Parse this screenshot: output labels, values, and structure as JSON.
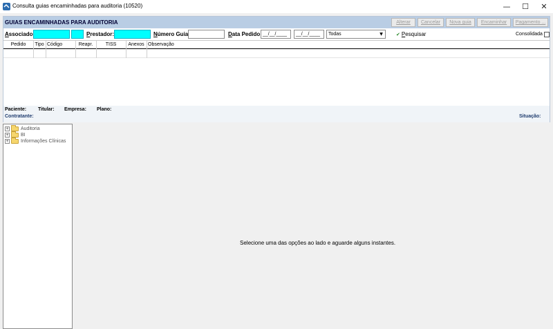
{
  "window": {
    "title": "Consulta guias encaminhadas para auditoria (10520)",
    "controls": {
      "minimize": "—",
      "maximize": "☐",
      "close": "✕"
    }
  },
  "header": {
    "title": "GUIAS ENCAMINHADAS PARA AUDITORIA",
    "buttons": [
      {
        "label": "Alterar"
      },
      {
        "label": "Cancelar"
      },
      {
        "label": "Nova guia"
      },
      {
        "label": "Encaminhar"
      },
      {
        "label": "Pagamento ..."
      }
    ]
  },
  "filters": {
    "associado": {
      "accel": "A",
      "rest": "ssociado:",
      "value": "",
      "code_value": ""
    },
    "prestador": {
      "accel": "P",
      "rest": "restador:",
      "value": ""
    },
    "numero_guia": {
      "accel": "N",
      "rest": "úmero Guia:",
      "value": ""
    },
    "data_pedido": {
      "accel": "D",
      "rest": "ata Pedido",
      "from": "__/__/____",
      "to": "__/__/____"
    },
    "status_select": {
      "selected": "Todas"
    },
    "pesquisar": {
      "accel": "P",
      "rest": "esquisar"
    },
    "consolidada": {
      "label": "Consolidada",
      "checked": false
    }
  },
  "grid": {
    "columns": [
      "Pedido",
      "Tipo",
      "Código",
      "Reapr.",
      "TISS",
      "Anexos",
      "Observação"
    ]
  },
  "info": {
    "paciente": "Paciente:",
    "titular": "Titular:",
    "empresa": "Empresa:",
    "plano": "Plano:",
    "contratante": "Contratante:",
    "situacao": "Situação:"
  },
  "tree": {
    "items": [
      {
        "label": "Auditoria",
        "expander": "+"
      },
      {
        "label": "BI",
        "expander": "+"
      },
      {
        "label": "Informações Clínicas",
        "expander": "+"
      }
    ]
  },
  "main": {
    "message": "Selecione uma das opções ao lado e aguarde alguns instantes."
  },
  "colors": {
    "header_bg": "#b9cde4",
    "input_highlight": "#00ffff",
    "label_blue": "#1f3c6e"
  }
}
